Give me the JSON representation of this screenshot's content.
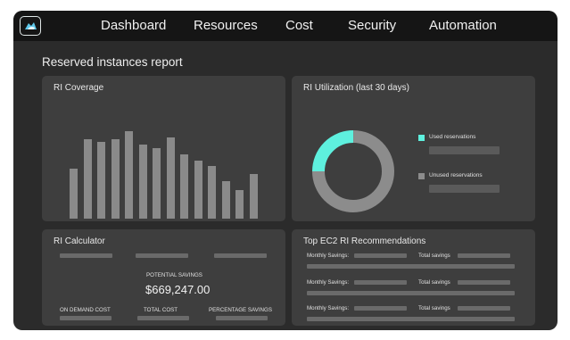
{
  "nav": {
    "items": [
      "Dashboard",
      "Resources",
      "Cost",
      "Security",
      "Automation"
    ]
  },
  "page": {
    "title": "Reserved instances report"
  },
  "coverage": {
    "title": "RI Coverage"
  },
  "chart_data": [
    {
      "type": "bar",
      "values": [
        56,
        89,
        86,
        89,
        98,
        83,
        79,
        91,
        72,
        65,
        59,
        42,
        32,
        50
      ],
      "ylim": [
        0,
        100
      ],
      "grid": false
    },
    {
      "type": "pie",
      "title": "RI Utilization (last 30 days)",
      "categories": [
        "Used reservations",
        "Unused reservations"
      ],
      "values": [
        25,
        75
      ]
    }
  ],
  "utilization": {
    "title": "RI Utilization (last 30 days)",
    "legend": [
      {
        "label": "Used reservations",
        "color": "#5ef0de"
      },
      {
        "label": "Unused reservations",
        "color": "#8c8c8c"
      }
    ]
  },
  "calculator": {
    "title": "RI Calculator",
    "potential_label": "POTENTIAL SAVINGS",
    "potential_value": "$669,247.00",
    "on_demand_label": "ON DEMAND COST",
    "total_cost_label": "TOTAL COST",
    "percentage_label": "PERCENTAGE SAVINGS"
  },
  "recommendations": {
    "title": "Top EC2 RI Recommendations",
    "rows": [
      {
        "monthly_label": "Monthly Savings:",
        "total_label": "Total savings"
      },
      {
        "monthly_label": "Monthly Savings:",
        "total_label": "Total savings"
      },
      {
        "monthly_label": "Monthly Savings:",
        "total_label": "Total savings"
      }
    ]
  },
  "colors": {
    "accent": "#5ef0de",
    "unused": "#8c8c8c",
    "background": "#2b2b2b",
    "card": "#3e3e3e",
    "topbar": "#151515"
  },
  "icons": {
    "logo": "cloud-logo-icon"
  }
}
